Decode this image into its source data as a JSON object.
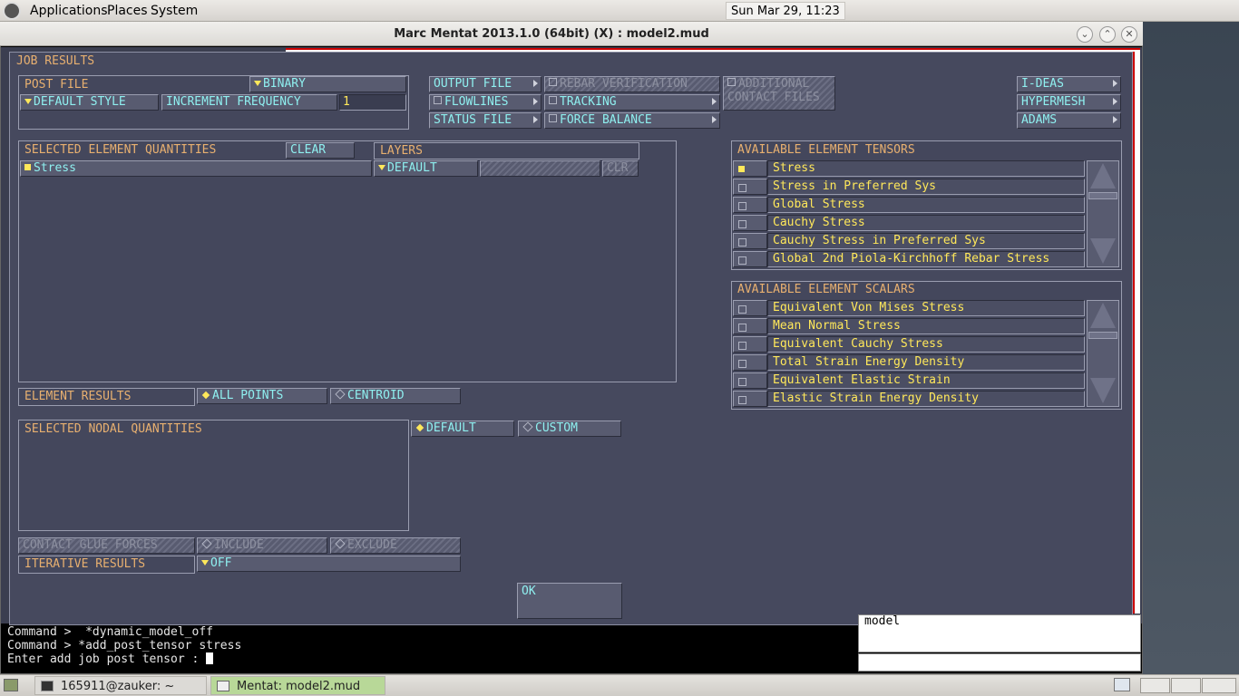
{
  "top_panel": {
    "menus": [
      "Applications",
      "Places",
      "System"
    ],
    "clock": "Sun Mar 29, 11:23"
  },
  "window": {
    "title": "Marc Mentat 2013.1.0 (64bit) (X) : model2.mud",
    "controls": [
      "minimize",
      "maximize",
      "close"
    ]
  },
  "dialog": {
    "title": "JOB RESULTS",
    "post_file": {
      "label": "POST FILE",
      "format": "BINARY",
      "style": "DEFAULT STYLE",
      "increment_label": "INCREMENT FREQUENCY",
      "increment_value": "1"
    },
    "middle_buttons": {
      "output_file": "OUTPUT FILE",
      "flowlines": "FLOWLINES",
      "status_file": "STATUS FILE",
      "rebar_verification": "REBAR VERIFICATION",
      "tracking": "TRACKING",
      "force_balance": "FORCE BALANCE",
      "additional_contact": "ADDITIONAL CONTACT FILES"
    },
    "export_buttons": [
      "I-DEAS",
      "HYPERMESH",
      "ADAMS"
    ],
    "selected_element": {
      "label": "SELECTED ELEMENT QUANTITIES",
      "clear": "CLEAR",
      "items": [
        "Stress"
      ],
      "layers_label": "LAYERS",
      "layers_value": "DEFAULT",
      "clr": "CLR"
    },
    "tensors": {
      "label": "AVAILABLE ELEMENT TENSORS",
      "items": [
        {
          "name": "Stress",
          "selected": true
        },
        {
          "name": "Stress in Preferred Sys",
          "selected": false
        },
        {
          "name": "Global Stress",
          "selected": false
        },
        {
          "name": "Cauchy Stress",
          "selected": false
        },
        {
          "name": "Cauchy Stress in Preferred Sys",
          "selected": false
        },
        {
          "name": "Global 2nd Piola-Kirchhoff Rebar Stress",
          "selected": false
        }
      ]
    },
    "scalars": {
      "label": "AVAILABLE ELEMENT SCALARS",
      "items": [
        {
          "name": "Equivalent Von Mises Stress",
          "selected": false
        },
        {
          "name": "Mean Normal Stress",
          "selected": false
        },
        {
          "name": "Equivalent Cauchy Stress",
          "selected": false
        },
        {
          "name": "Total Strain Energy Density",
          "selected": false
        },
        {
          "name": "Equivalent Elastic Strain",
          "selected": false
        },
        {
          "name": "Elastic Strain Energy Density",
          "selected": false
        }
      ]
    },
    "element_results": {
      "label": "ELEMENT RESULTS",
      "all_points": "ALL POINTS",
      "centroid": "CENTROID",
      "selected": "ALL POINTS"
    },
    "nodal": {
      "label": "SELECTED NODAL QUANTITIES",
      "default": "DEFAULT",
      "custom": "CUSTOM",
      "selected": "DEFAULT"
    },
    "contact_glue": {
      "label": "CONTACT GLUE FORCES",
      "include": "INCLUDE",
      "exclude": "EXCLUDE"
    },
    "iterative": {
      "label": "ITERATIVE RESULTS",
      "value": "OFF"
    },
    "ok": "OK"
  },
  "command": {
    "lines": [
      "Command >  *dynamic_model_off",
      "Command > *add_post_tensor stress",
      "Enter add job post tensor : "
    ],
    "side_text": "model"
  },
  "taskbar": {
    "tasks": [
      "165911@zauker: ~",
      "Mentat: model2.mud"
    ]
  },
  "colors": {
    "dialog_bg": "#46495e",
    "label": "#e8b070",
    "button_text": "#8ff0f0",
    "value_text": "#ffe85a"
  }
}
